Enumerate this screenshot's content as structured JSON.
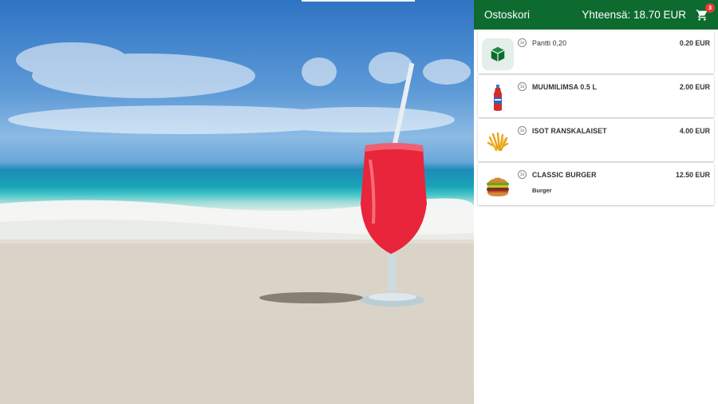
{
  "cart": {
    "title": "Ostoskori",
    "total_label": "Yhteensä: 18.70 EUR",
    "badge_count": "3",
    "items": [
      {
        "qty": "1x",
        "name": "Pantti 0,20",
        "price": "0.20 EUR",
        "sub": "",
        "icon": "deposit-box-icon"
      },
      {
        "qty": "1x",
        "name": "MUUMILIMSA 0.5 L",
        "price": "2.00 EUR",
        "sub": "",
        "icon": "soda-bottle-image"
      },
      {
        "qty": "1x",
        "name": "ISOT RANSKALAISET",
        "price": "4.00 EUR",
        "sub": "",
        "icon": "french-fries-image"
      },
      {
        "qty": "1x",
        "name": "CLASSIC BURGER",
        "price": "12.50 EUR",
        "sub": "Burger",
        "icon": "burger-image"
      }
    ]
  },
  "colors": {
    "header_bg": "#0d6b2f",
    "badge_bg": "#e53935",
    "deposit_icon_bg": "#e3efe8",
    "deposit_icon_fg": "#0d6b2f"
  }
}
